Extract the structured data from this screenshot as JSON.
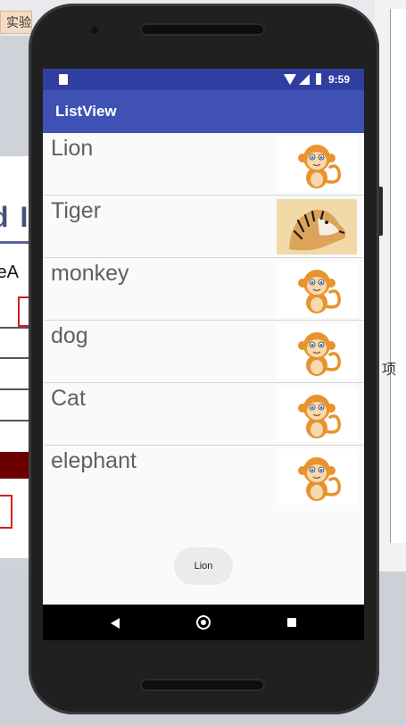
{
  "background": {
    "tab_label": "实验",
    "heading_fragment": "d I",
    "text_fragment": "leA",
    "right_char": "项"
  },
  "status_bar": {
    "time": "9:59"
  },
  "app_bar": {
    "title": "ListView"
  },
  "list_items": [
    {
      "label": "Lion",
      "image": "monkey-image"
    },
    {
      "label": "Tiger",
      "image": "tiger-image"
    },
    {
      "label": "monkey",
      "image": "monkey-image"
    },
    {
      "label": "dog",
      "image": "monkey-image"
    },
    {
      "label": "Cat",
      "image": "monkey-image"
    },
    {
      "label": "elephant",
      "image": "monkey-image"
    }
  ],
  "toast": {
    "text": "Lion"
  },
  "colors": {
    "status_bar": "#303f9f",
    "app_bar": "#3f51b5",
    "list_text": "#606060",
    "list_background": "#fafafa",
    "monkey_orange": "#e8932e",
    "tiger_background": "#f1d9a8"
  }
}
